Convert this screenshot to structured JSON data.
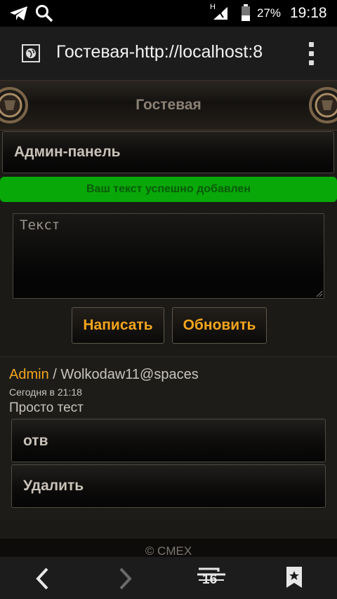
{
  "status_bar": {
    "signal": "H",
    "battery_percent": "27%",
    "time": "19:18"
  },
  "browser": {
    "url_title": "Гостевая-http://localhost:8",
    "icons": [
      "globe-icon",
      "overflow-menu-icon"
    ]
  },
  "page": {
    "header_title": "Гостевая",
    "admin_panel_label": "Админ-панель",
    "success_message": "Ваш текст успешно добавлен",
    "textarea_placeholder": "Текст",
    "buttons": {
      "write": "Написать",
      "refresh": "Обновить"
    },
    "post": {
      "author": "Admin",
      "separator": " / ",
      "recipient": "Wolkodaw11@spaces",
      "date": "Сегодня в 21:18",
      "text": "Просто тест",
      "reply_label": "отв",
      "delete_label": "Удалить"
    },
    "footer": "© CMEX"
  },
  "nav_bar": {
    "tabs_count": "16"
  },
  "colors": {
    "accent": "#f4a51d",
    "success": "#07a807",
    "background": "#1b1a17"
  }
}
